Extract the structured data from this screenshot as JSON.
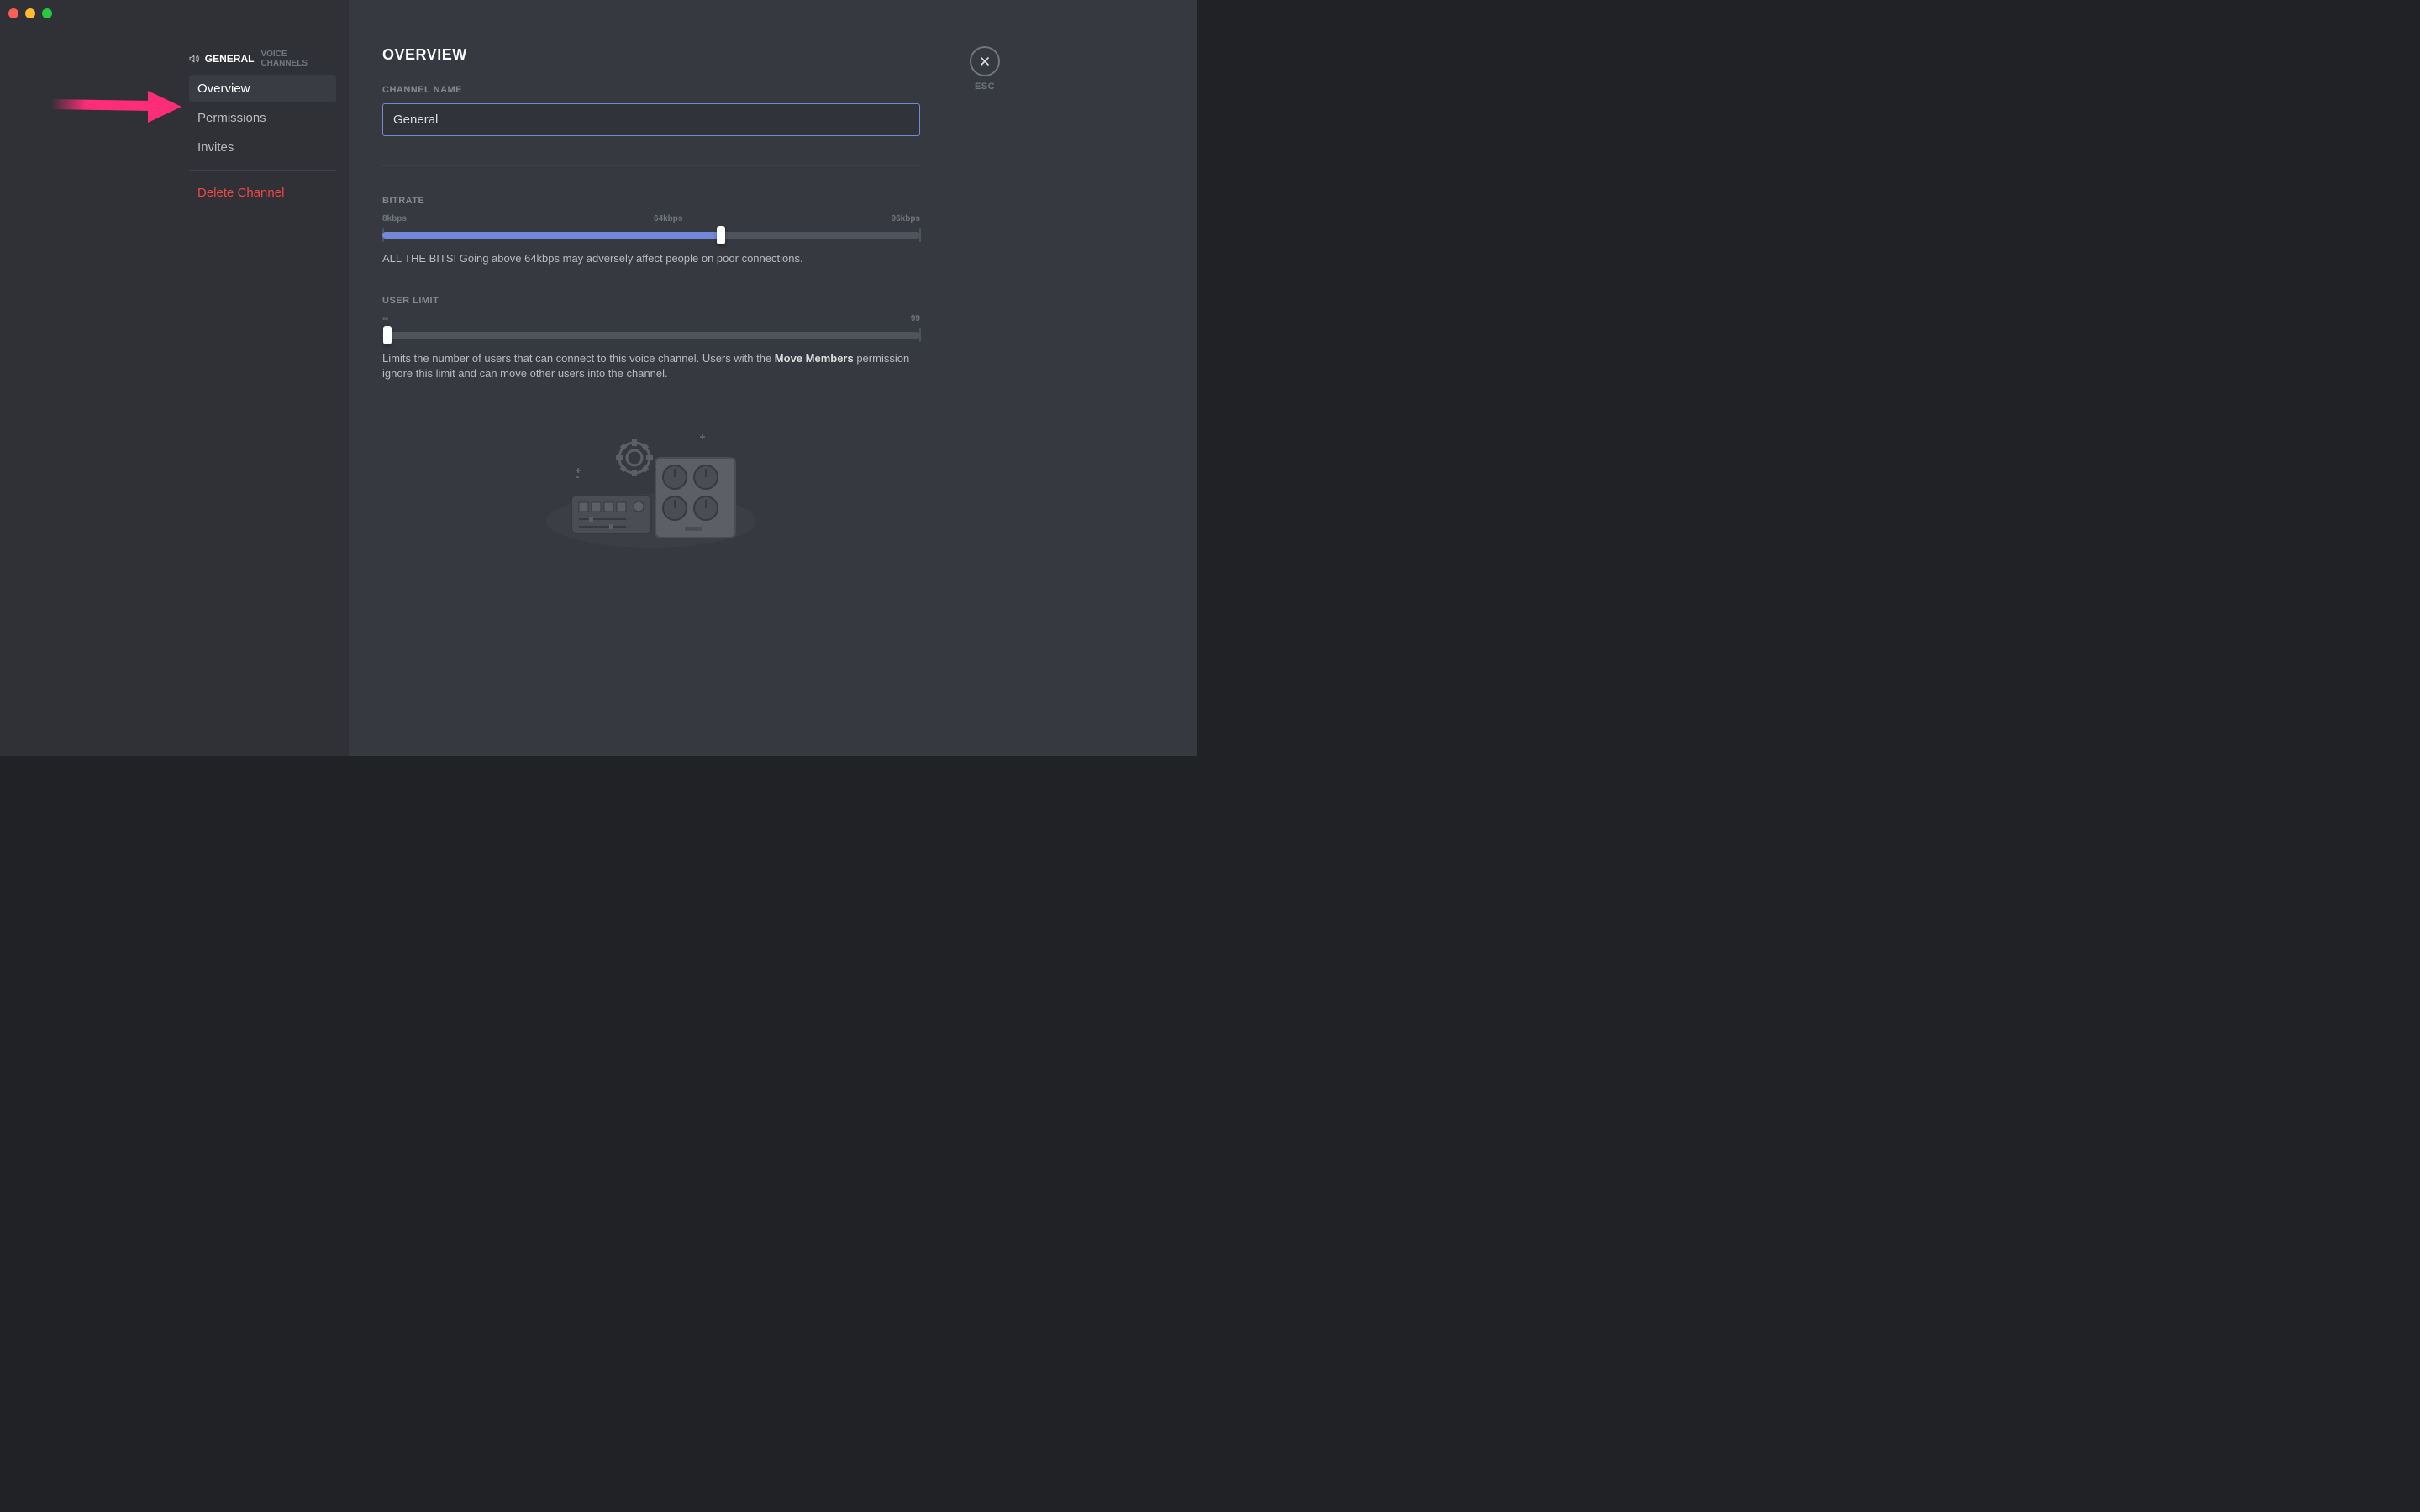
{
  "sidebar": {
    "channelName": "GENERAL",
    "channelType": "VOICE CHANNELS",
    "items": [
      {
        "label": "Overview",
        "active": true
      },
      {
        "label": "Permissions",
        "active": false
      },
      {
        "label": "Invites",
        "active": false
      }
    ],
    "deleteLabel": "Delete Channel"
  },
  "main": {
    "title": "OVERVIEW",
    "channelName": {
      "label": "CHANNEL NAME",
      "value": "General"
    },
    "bitrate": {
      "label": "BITRATE",
      "min": "8kbps",
      "mid": "64kbps",
      "max": "96kbps",
      "valuePercent": 63,
      "helper": "ALL THE BITS! Going above 64kbps may adversely affect people on poor connections."
    },
    "userLimit": {
      "label": "USER LIMIT",
      "min": "∞",
      "max": "99",
      "valuePercent": 0,
      "helperPrefix": "Limits the number of users that can connect to this voice channel. Users with the ",
      "helperBold": "Move Members",
      "helperSuffix": " permission ignore this limit and can move other users into the channel."
    }
  },
  "close": {
    "label": "ESC"
  }
}
